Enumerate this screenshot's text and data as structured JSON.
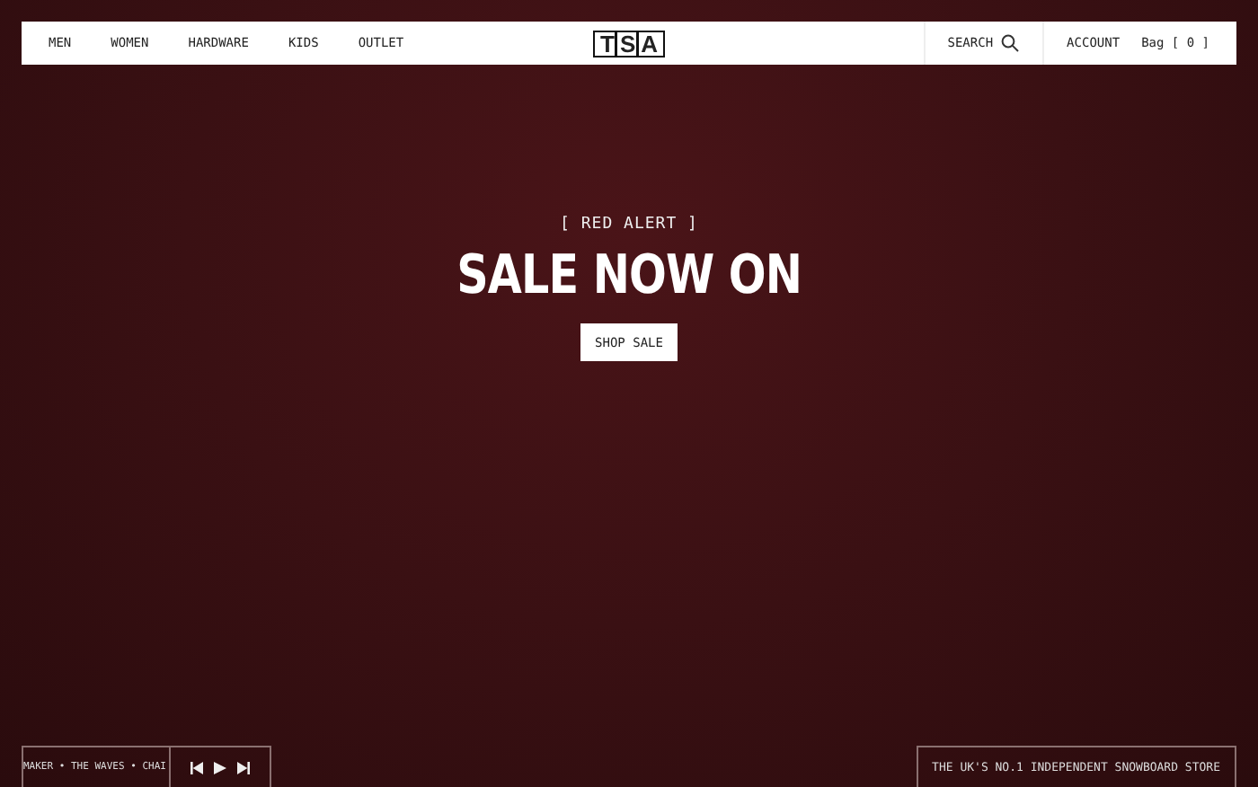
{
  "nav": {
    "links": [
      {
        "label": "MEN"
      },
      {
        "label": "WOMEN"
      },
      {
        "label": "HARDWARE"
      },
      {
        "label": "KIDS"
      },
      {
        "label": "OUTLET"
      }
    ],
    "logo": "TSA",
    "search": "SEARCH",
    "account": "ACCOUNT",
    "bag": "Bag [ 0 ]"
  },
  "hero": {
    "eyebrow": "[ RED ALERT ]",
    "title": "SALE NOW ON",
    "button": "SHOP SALE"
  },
  "player": {
    "ticker": "MAKER • THE WAVES • CHAI"
  },
  "tagline": "THE UK'S NO.1 INDEPENDENT SNOWBOARD STORE"
}
